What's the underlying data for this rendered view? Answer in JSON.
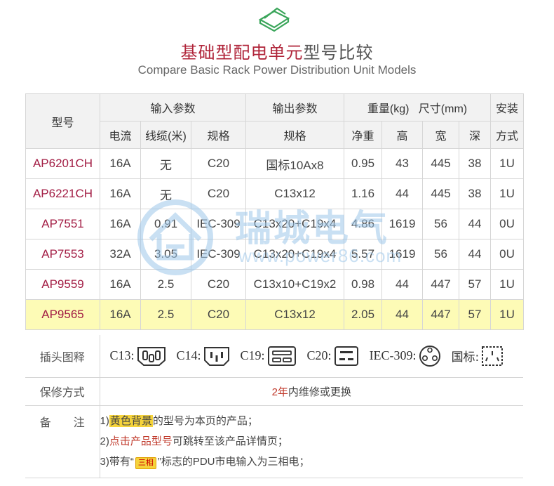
{
  "header": {
    "title_accent": "基础型配电单元",
    "title_rest": "型号比较",
    "subtitle": "Compare Basic Rack Power Distribution Unit Models"
  },
  "table": {
    "col_model": "型号",
    "group_input": "输入参数",
    "group_output": "输出参数",
    "group_weight_size": "重量(kg)   尺寸(mm)",
    "group_install_top": "安装",
    "sub_current": "电流",
    "sub_cable": "线缆(米)",
    "sub_spec_in": "规格",
    "sub_spec_out": "规格",
    "sub_net": "净重",
    "sub_h": "高",
    "sub_w": "宽",
    "sub_d": "深",
    "sub_install": "方式",
    "rows": [
      {
        "model": "AP6201CH",
        "current": "16A",
        "cable": "无",
        "spec_in": "C20",
        "spec_out": "国标10Ax8",
        "net": "0.95",
        "h": "43",
        "w": "445",
        "d": "38",
        "install": "1U"
      },
      {
        "model": "AP6221CH",
        "current": "16A",
        "cable": "无",
        "spec_in": "C20",
        "spec_out": "C13x12",
        "net": "1.16",
        "h": "44",
        "w": "445",
        "d": "38",
        "install": "1U"
      },
      {
        "model": "AP7551",
        "current": "16A",
        "cable": "0.91",
        "spec_in": "IEC-309",
        "spec_out": "C13x20+C19x4",
        "net": "4.86",
        "h": "1619",
        "w": "56",
        "d": "44",
        "install": "0U"
      },
      {
        "model": "AP7553",
        "current": "32A",
        "cable": "3.05",
        "spec_in": "IEC-309",
        "spec_out": "C13x20+C19x4",
        "net": "5.57",
        "h": "1619",
        "w": "56",
        "d": "44",
        "install": "0U"
      },
      {
        "model": "AP9559",
        "current": "16A",
        "cable": "2.5",
        "spec_in": "C20",
        "spec_out": "C13x10+C19x2",
        "net": "0.98",
        "h": "44",
        "w": "447",
        "d": "57",
        "install": "1U"
      },
      {
        "model": "AP9565",
        "current": "16A",
        "cable": "2.5",
        "spec_in": "C20",
        "spec_out": "C13x12",
        "net": "2.05",
        "h": "44",
        "w": "447",
        "d": "57",
        "install": "1U"
      }
    ]
  },
  "plugs": {
    "label": "插头图释",
    "items": [
      "C13:",
      "C14:",
      "C19:",
      "C20:",
      "IEC-309:",
      "国标:"
    ]
  },
  "warranty": {
    "label": "保修方式",
    "years": "2年",
    "text": "内维修或更换"
  },
  "notes": {
    "label": "备　　注",
    "n1_prefix": "1)",
    "n1_highlight": "黄色背景",
    "n1_rest": "的型号为本页的产品；",
    "n2_prefix": "2)",
    "n2_red": "点击产品型号",
    "n2_rest": "可跳转至该产品详情页；",
    "n3_prefix": "3)带有“",
    "n3_badge": "三相",
    "n3_rest": "”标志的PDU市电输入为三相电；"
  },
  "watermark": {
    "cn": "瑞城电气",
    "url": "www.power86.com"
  },
  "colors": {
    "accent": "#b0253a",
    "highlight_row": "#fdfbb6",
    "header_bg": "#f2f2f2",
    "logo_green": "#3aa55a"
  }
}
